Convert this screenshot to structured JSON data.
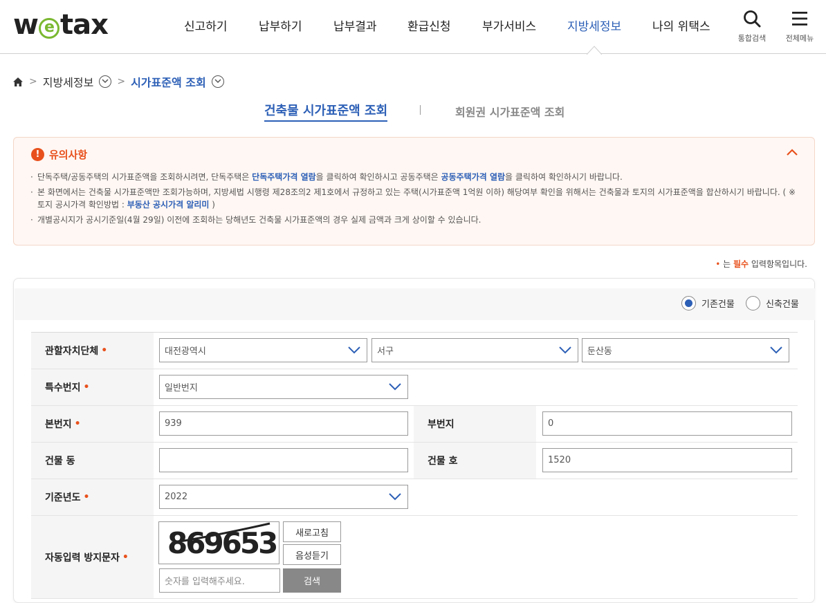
{
  "brand": {
    "logo_pre": "w",
    "logo_e": "e",
    "logo_post": "tax",
    "accent": "#2c5fb6",
    "warn": "#e8511d"
  },
  "nav": {
    "items": [
      "신고하기",
      "납부하기",
      "납부결과",
      "환급신청",
      "부가서비스",
      "지방세정보",
      "나의 위택스"
    ],
    "search_label": "통합검색",
    "menu_label": "전체메뉴"
  },
  "breadcrumb": {
    "level1": "지방세정보",
    "level2": "시가표준액 조회"
  },
  "tabs": {
    "building": "건축물 시가표준액 조회",
    "membership": "회원권 시가표준액 조회"
  },
  "notice": {
    "title": "유의사항",
    "item1_a": "단독주택/공동주택의 시가표준액을 조회하시려면, 단독주택은 ",
    "item1_link1": "단독주택가격 열람",
    "item1_b": "을 클릭하여 확인하시고 공동주택은 ",
    "item1_link2": "공동주택가격 열람",
    "item1_c": "을 클릭하여 확인하시기 바랍니다.",
    "item2_a": "본 화면에서는 건축물 시가표준액만 조회가능하며, 지방세법 시행령 제28조의2 제1호에서 규정하고 있는 주택(시가표준액 1억원 이하) 해당여부 확인을 위해서는 건축물과 토지의 시가표준액을 합산하시기 바랍니다. ( ※ 토지 공시가격 확인방법 : ",
    "item2_link": "부동산 공시가격 알리미",
    "item2_b": " )",
    "item3": "개별공시지가 공시기준일(4월 29일) 이전에 조회하는 당해년도 건축물 시가표준액의 경우 실제 금액과 크게 상이할 수 있습니다."
  },
  "required_note": {
    "dot": "•",
    "pre": " 는 ",
    "must": "필수",
    "post": " 입력항목입니다."
  },
  "building_type": {
    "existing": "기존건물",
    "new": "신축건물",
    "selected": "existing"
  },
  "form": {
    "jurisdiction_label": "관할자치단체",
    "city": "대전광역시",
    "district": "서구",
    "dong": "둔산동",
    "special_label": "특수번지",
    "special_value": "일반번지",
    "main_no_label": "본번지",
    "main_no": "939",
    "sub_no_label": "부번지",
    "sub_no": "0",
    "bldg_dong_label": "건물 동",
    "bldg_dong": "",
    "bldg_ho_label": "건물 호",
    "bldg_ho": "1520",
    "year_label": "기준년도",
    "year": "2022",
    "captcha_label": "자동입력 방지문자",
    "captcha_text": "869653",
    "refresh": "새로고침",
    "listen": "음성듣기",
    "captcha_placeholder": "숫자를 입력해주세요.",
    "search": "검색",
    "star": "•"
  }
}
